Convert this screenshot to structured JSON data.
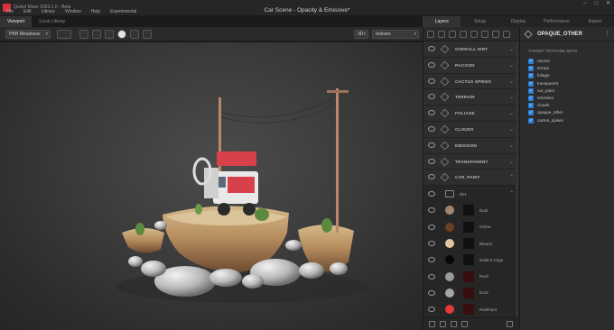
{
  "app": {
    "name": "Quixel Mixer 2023.1.0 - Beta",
    "document_title": "Car Scene - Opacity & Emissive*",
    "menu": [
      "File",
      "Edit",
      "Library",
      "Window",
      "Help",
      "Experimental"
    ]
  },
  "left_tabs": [
    "Viewport",
    "Local Library"
  ],
  "right_tabs": [
    "Layers",
    "Setup",
    "Display",
    "Performance",
    "Export"
  ],
  "toolbar": {
    "shading_mode": "PBR Metalness",
    "view_mode": "3D",
    "environment": "Indoors"
  },
  "layers": [
    {
      "name": "OVERALL DIRT"
    },
    {
      "name": "RACOON"
    },
    {
      "name": "CACTUS SPIKES"
    },
    {
      "name": "TERRAIN"
    },
    {
      "name": "FOLIAGE"
    },
    {
      "name": "CLOUDS"
    },
    {
      "name": "EMISSION"
    },
    {
      "name": "TRANSPARENT"
    },
    {
      "name": "CAR_PAINT"
    }
  ],
  "folder": {
    "name": "Dirt"
  },
  "sub_layers": [
    {
      "name": "Dust",
      "color": "#a08670"
    },
    {
      "name": "Grime",
      "color": "#6b3f22"
    },
    {
      "name": "Bleach",
      "color": "#e2c6a2"
    },
    {
      "name": "Solid 5 Copy",
      "color": "#080808"
    },
    {
      "name": "Roof",
      "color": "#9a9a9a"
    },
    {
      "name": "Door",
      "color": "#a6a6a6"
    },
    {
      "name": "RedPaint",
      "color": "#e23a38"
    }
  ],
  "properties": {
    "title": "OPAQUE_OTHER",
    "texture_sets_label": "TARGET TEXTURE SETS",
    "texture_sets": [
      "racoon",
      "terrain",
      "foliage",
      "transparent",
      "car_paint",
      "emission",
      "clouds",
      "opaque_other",
      "cactus_spikes"
    ]
  },
  "colors": {
    "accent": "#2b7fd6",
    "brand": "#d8333a",
    "car_red": "#d8404a"
  }
}
